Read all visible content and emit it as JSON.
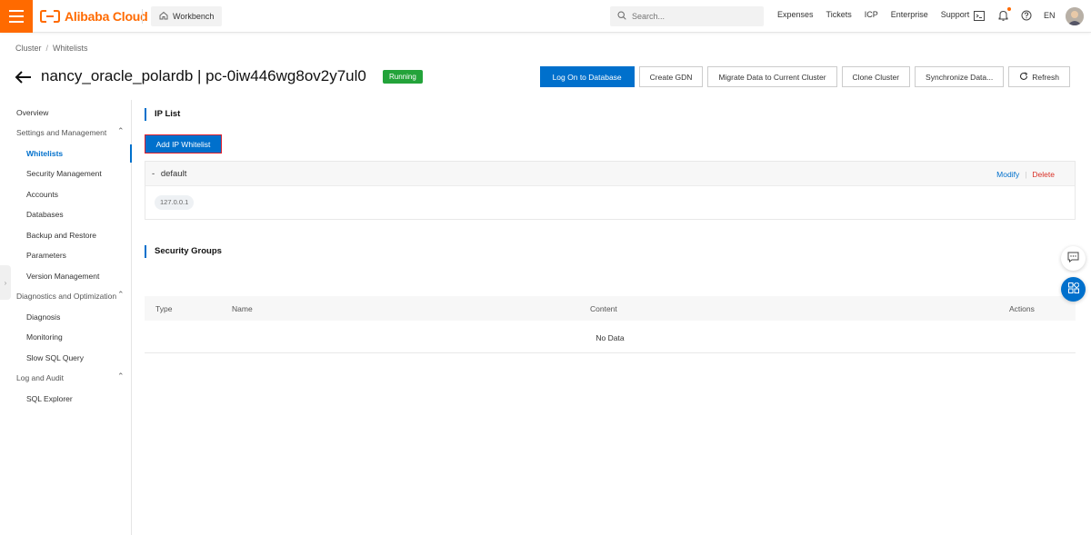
{
  "header": {
    "logo_text": "Alibaba Cloud",
    "workbench_label": "Workbench",
    "search_placeholder": "Search...",
    "links": [
      "Expenses",
      "Tickets",
      "ICP",
      "Enterprise",
      "Support"
    ],
    "language": "EN"
  },
  "breadcrumb": [
    "Cluster",
    "/",
    "Whitelists"
  ],
  "page": {
    "title": "nancy_oracle_polardb | pc-0iw446wg8ov2y7ul0",
    "status": "Running"
  },
  "actions": {
    "log_on": "Log On to Database",
    "create_gdn": "Create GDN",
    "migrate": "Migrate Data to Current Cluster",
    "clone": "Clone Cluster",
    "sync": "Synchronize Data...",
    "refresh": "Refresh"
  },
  "sidebar": {
    "overview": "Overview",
    "groups": [
      {
        "label": "Settings and Management",
        "items": [
          "Whitelists",
          "Security Management",
          "Accounts",
          "Databases",
          "Backup and Restore",
          "Parameters",
          "Version Management"
        ]
      },
      {
        "label": "Diagnostics and Optimization",
        "items": [
          "Diagnosis",
          "Monitoring",
          "Slow SQL Query"
        ]
      },
      {
        "label": "Log and Audit",
        "items": [
          "SQL Explorer"
        ]
      }
    ]
  },
  "ip_list": {
    "title": "IP List",
    "add_button": "Add IP Whitelist",
    "group_prefix": "-",
    "group_name": "default",
    "modify": "Modify",
    "separator": "|",
    "delete": "Delete",
    "ips": [
      "127.0.0.1"
    ]
  },
  "security_groups": {
    "title": "Security Groups",
    "columns": [
      "Type",
      "Name",
      "Content",
      "Actions"
    ],
    "empty_text": "No Data"
  },
  "colors": {
    "brand_orange": "#ff6a00",
    "primary_blue": "#0070cc",
    "status_green": "#23a33a",
    "danger_red": "#d93026"
  }
}
